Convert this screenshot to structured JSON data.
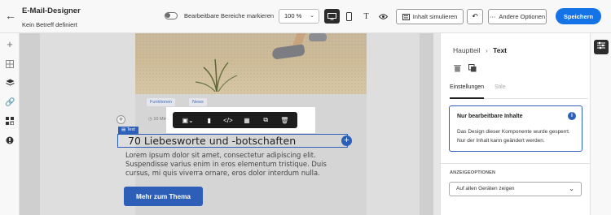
{
  "header": {
    "title": "E-Mail-Designer",
    "subtitle": "Kein Betreff definiert",
    "toggle_label": "Bearbeitbare Bereiche markieren",
    "zoom": "100 %",
    "simulate_label": "Inhalt simulieren",
    "more_label": "Andere Optionen",
    "save_label": "Speichern",
    "accent_color": "#1473e6"
  },
  "left_rail": {
    "icons": [
      "plus-icon",
      "structure-icon",
      "layers-icon",
      "link-icon",
      "fragments-icon",
      "personalization-icon"
    ]
  },
  "email": {
    "chips": [
      "Funktionen",
      "News"
    ],
    "meta_time": "10 Min.",
    "selection_tag": "Text",
    "heading": "70 Liebesworte und -botschaften",
    "body": "Lorem ipsum dolor sit amet, consectetur adipiscing elit. Suspendisse varius enim in eros elementum tristique. Duis cursus, mi quis viverra ornare, eros dolor interdum nulla.",
    "cta_label": "Mehr zum Thema",
    "selection_color": "#2d5fb8"
  },
  "panel": {
    "breadcrumb_parent": "Hauptteil",
    "breadcrumb_current": "Text",
    "tabs": [
      "Einstellungen",
      "Stile"
    ],
    "info_title": "Nur bearbeitbare Inhalte",
    "info_text": "Das Design dieser Komponente wurde gesperrt. Nur der Inhalt kann geändert werden.",
    "section_label": "ANZEIGEOPTIONEN",
    "display_select_value": "Auf allen Geräten zeigen"
  }
}
